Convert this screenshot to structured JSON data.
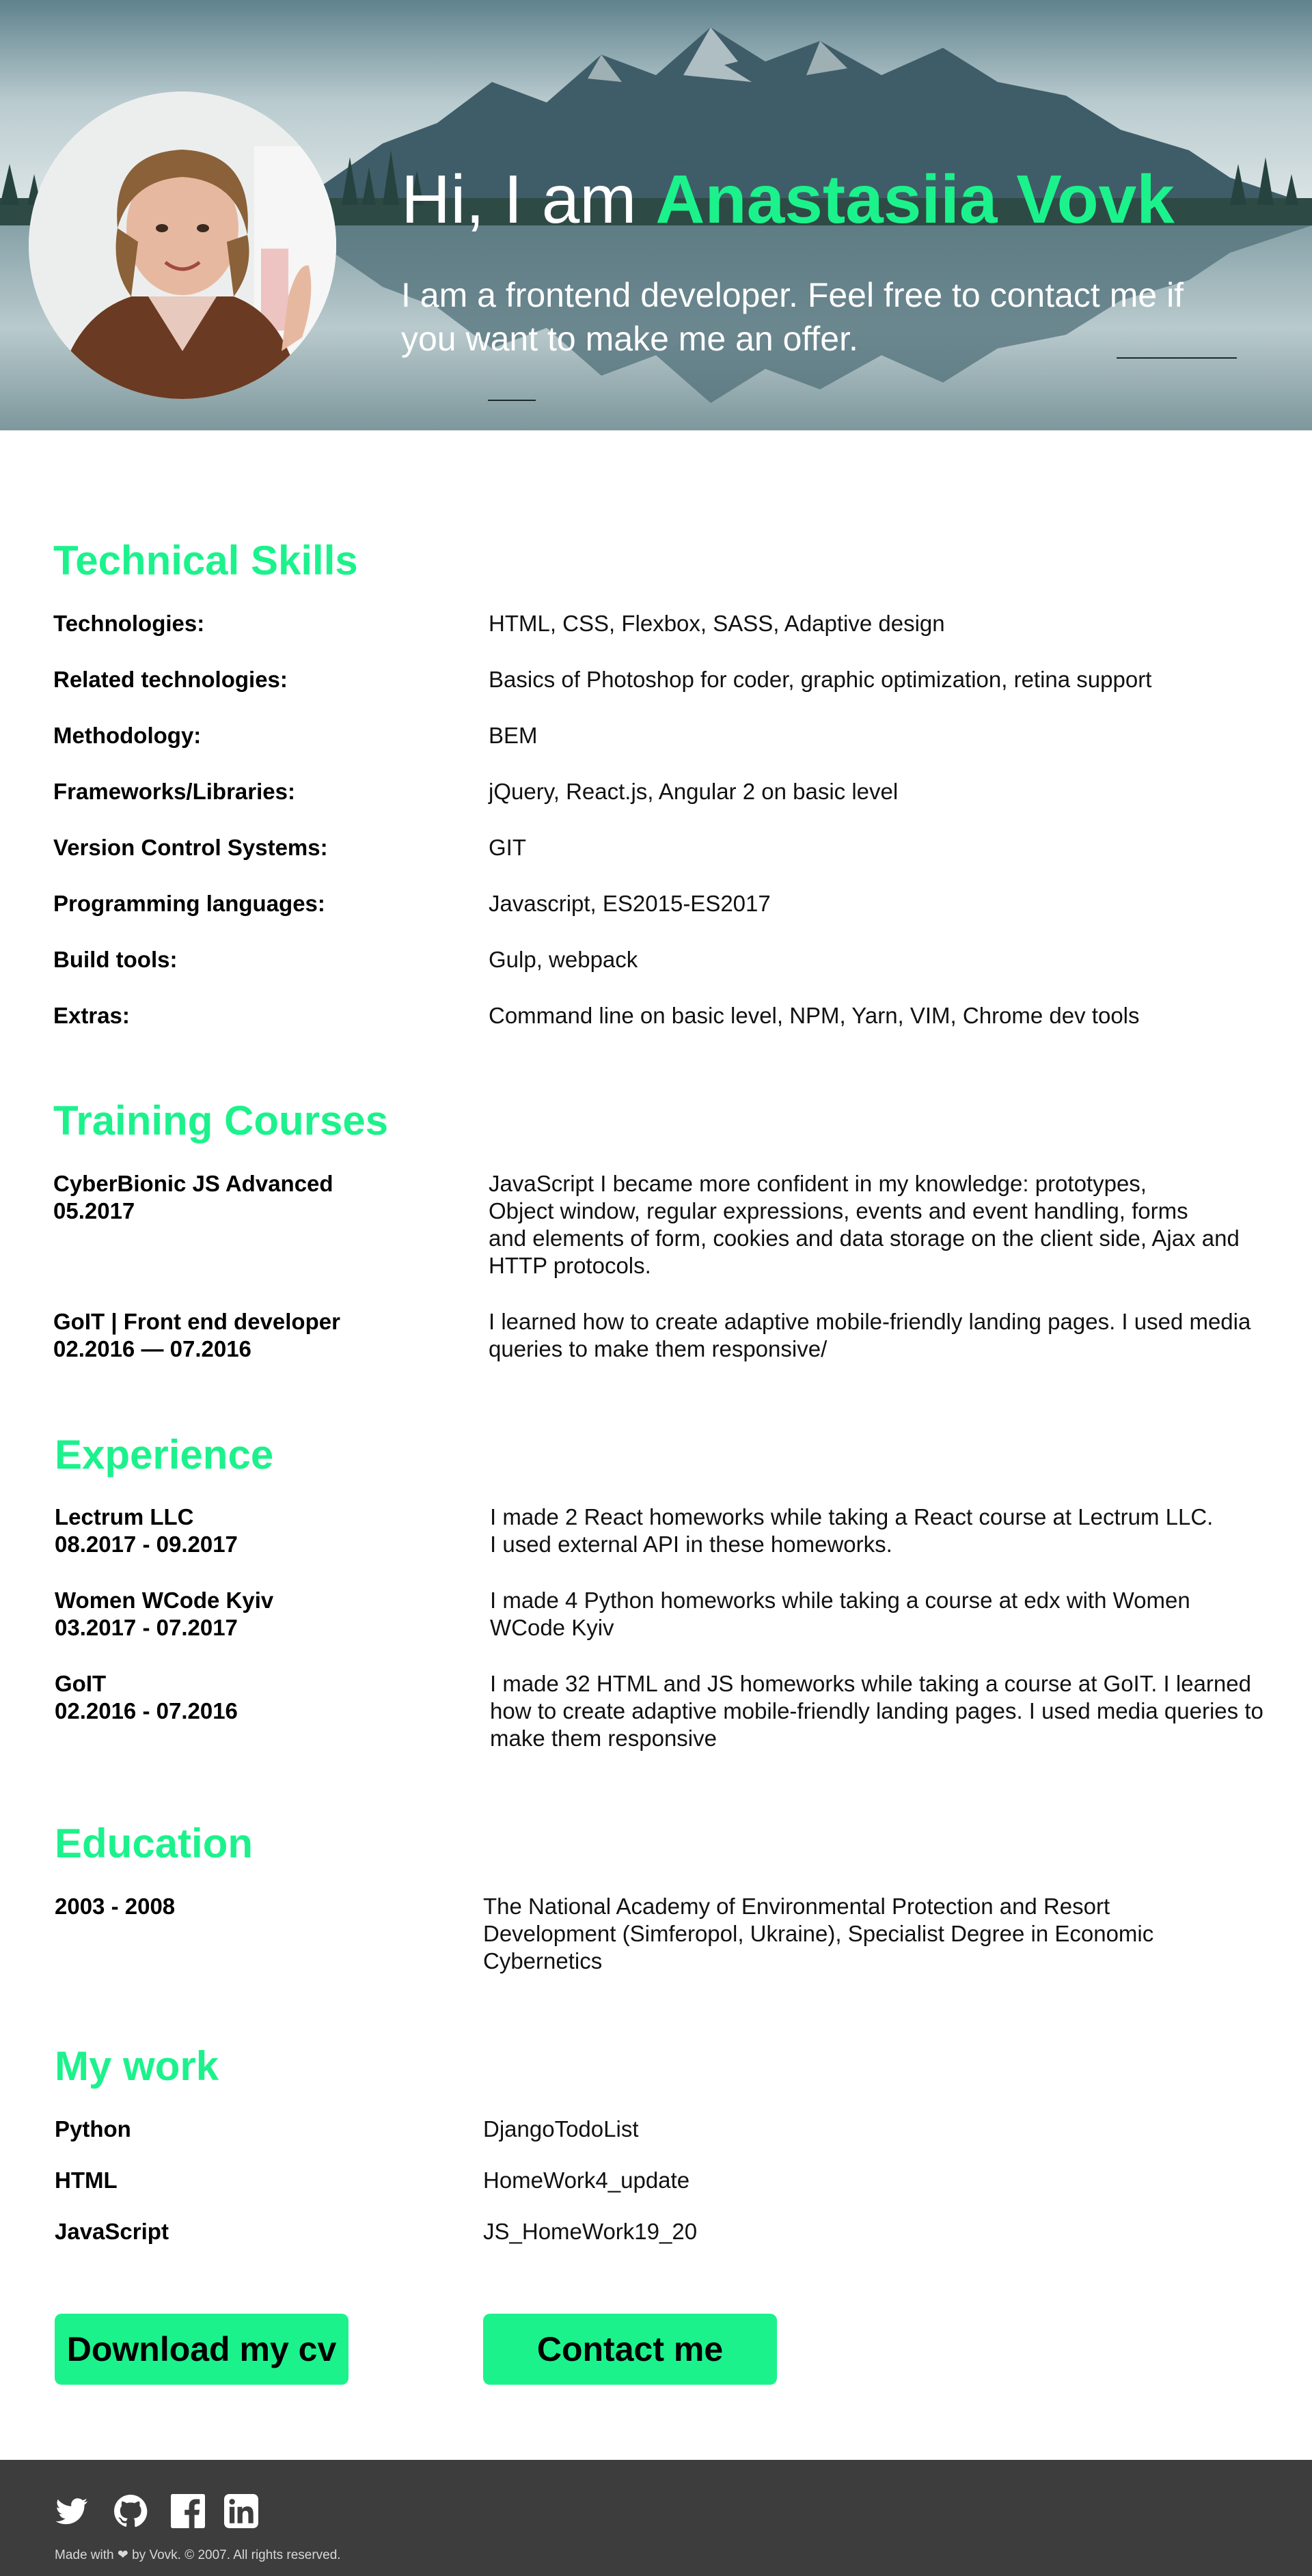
{
  "hero": {
    "greeting": "Hi, I am",
    "name": "Anastasiia Vovk",
    "subtitle": "I am a frontend developer. Feel free to contact me if you want to make me an offer."
  },
  "sections": {
    "technical_skills": {
      "title": "Technical Skills",
      "rows": [
        {
          "label": "Technologies:",
          "value": "HTML, CSS, Flexbox, SASS, Adaptive design"
        },
        {
          "label": "Related technologies:",
          "value": "Basics of Photoshop for coder, graphic optimization, retina support"
        },
        {
          "label": "Methodology:",
          "value": "BEM"
        },
        {
          "label": "Frameworks/Libraries:",
          "value": "jQuery, React.js, Angular 2 on basic level"
        },
        {
          "label": "Version Control Systems:",
          "value": "GIT"
        },
        {
          "label": "Programming languages:",
          "value": "Javascript, ES2015-ES2017"
        },
        {
          "label": "Build tools:",
          "value": "Gulp,  webpack"
        },
        {
          "label": "Extras:",
          "value": "Command line on basic level, NPM, Yarn, VIM, Chrome dev tools"
        }
      ]
    },
    "training": {
      "title": "Training Courses",
      "rows": [
        {
          "label1": "CyberBionic JS Advanced",
          "label2": "05.2017",
          "lines": [
            "JavaScript I became more confident in my knowledge: prototypes,",
            "Object window, regular expressions, events and event handling, forms",
            "and elements of form, cookies and data storage on the client side, Ajax and",
            "HTTP protocols."
          ]
        },
        {
          "label1": "GoIT | Front end developer",
          "label2": "02.2016 — 07.2016",
          "lines": [
            "I learned how to create adaptive mobile-friendly landing pages. I used media",
            "queries to make them responsive/"
          ]
        }
      ]
    },
    "experience": {
      "title": "Experience",
      "rows": [
        {
          "label1": "Lectrum LLC",
          "label2": "08.2017 - 09.2017",
          "lines": [
            "I made 2 React homeworks while taking a React course at Lectrum LLC.",
            "I used external API in these homeworks."
          ]
        },
        {
          "label1": "Women WCode Kyiv",
          "label2": "03.2017 - 07.2017",
          "lines": [
            "I made 4 Python homeworks while taking a course at edx with Women",
            "WCode Kyiv"
          ]
        },
        {
          "label1": "GoIT",
          "label2": "02.2016 - 07.2016",
          "lines": [
            "I made 32 HTML and JS homeworks while taking a course at GoIT. I learned",
            "how to create adaptive mobile-friendly landing pages. I used media queries to",
            "make them responsive"
          ]
        }
      ]
    },
    "education": {
      "title": "Education",
      "rows": [
        {
          "label": "2003 - 2008",
          "lines": [
            "The National Academy of Environmental Protection and Resort",
            "Development (Simferopol, Ukraine), Specialist Degree in Economic",
            "Cybernetics"
          ]
        }
      ]
    },
    "my_work": {
      "title": "My work",
      "rows": [
        {
          "label": "Python",
          "link": "DjangoTodoList"
        },
        {
          "label": "HTML",
          "link": "HomeWork4_update"
        },
        {
          "label": "JavaScript",
          "link": "JS_HomeWork19_20"
        }
      ]
    }
  },
  "buttons": {
    "download": "Download my cv",
    "contact": "Contact me"
  },
  "footer": {
    "social": [
      "twitter-icon",
      "github-icon",
      "facebook-icon",
      "linkedin-icon"
    ],
    "made_with": "Made with",
    "heart": "❤",
    "rest": "by Vovk. © 2007. All rights reserved."
  },
  "colors": {
    "accent": "#1cf28c",
    "footer_bg": "#3d3d3d"
  }
}
